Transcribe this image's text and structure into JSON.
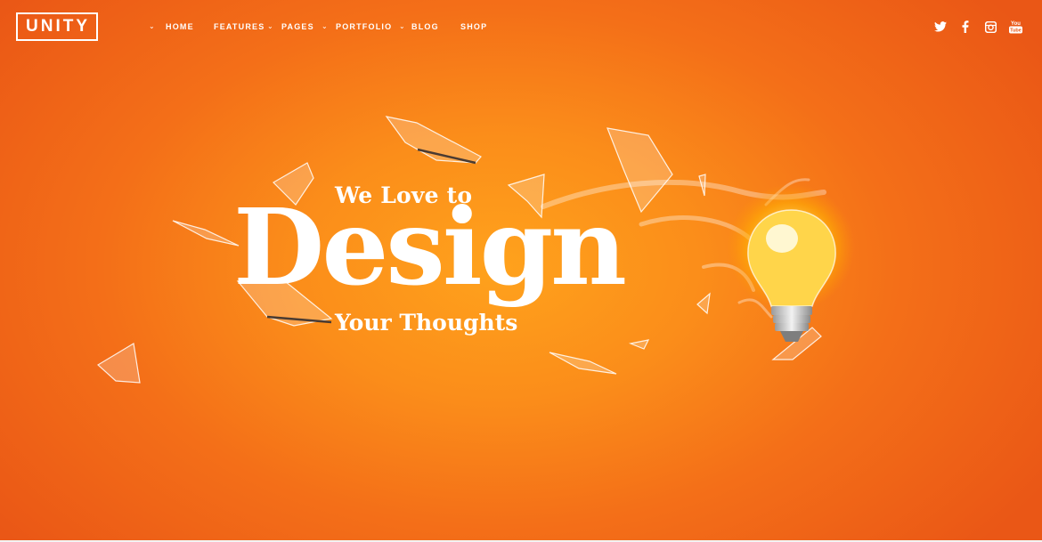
{
  "brand": {
    "logo_text": "UNITY"
  },
  "nav": {
    "items": [
      {
        "label": "HOME",
        "has_dropdown": true
      },
      {
        "label": "FEATURES",
        "has_dropdown": true
      },
      {
        "label": "PAGES",
        "has_dropdown": true
      },
      {
        "label": "PORTFOLIO",
        "has_dropdown": true
      },
      {
        "label": "BLOG",
        "has_dropdown": false
      },
      {
        "label": "SHOP",
        "has_dropdown": false
      }
    ],
    "caret_glyph": "⌄"
  },
  "social": {
    "icons": [
      "twitter-icon",
      "facebook-icon",
      "instagram-icon",
      "youtube-icon"
    ],
    "youtube_text_top": "You",
    "youtube_text_bottom": "Tube"
  },
  "hero": {
    "line1": "We Love to",
    "headline": "Design",
    "line3": "Your Thoughts"
  },
  "colors": {
    "background_center": "#ffa21c",
    "background_edge": "#ea5716",
    "text": "#ffffff",
    "bulb_glow": "#ffe066"
  }
}
